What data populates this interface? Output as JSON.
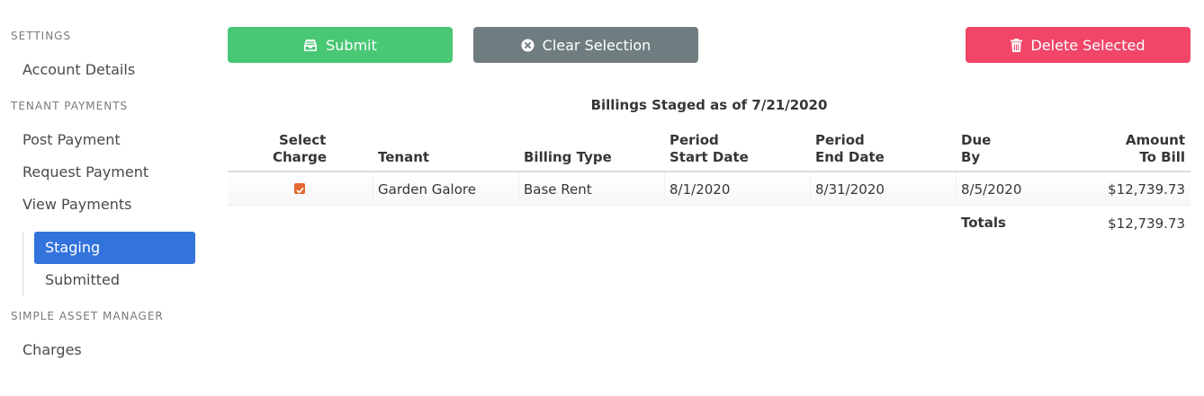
{
  "sidebar": {
    "sections": [
      {
        "label": "SETTINGS",
        "items": [
          "Account Details"
        ]
      },
      {
        "label": "TENANT PAYMENTS",
        "items": [
          "Post Payment",
          "Request Payment",
          "View Payments"
        ]
      },
      {
        "label": "SIMPLE ASSET MANAGER",
        "items": [
          "Charges"
        ]
      }
    ],
    "sub_items": [
      "Staging",
      "Submitted"
    ],
    "active_sub_item": "Staging"
  },
  "toolbar": {
    "submit_label": "Submit",
    "clear_label": "Clear Selection",
    "delete_label": "Delete Selected"
  },
  "table": {
    "caption": "Billings Staged as of 7/21/2020",
    "headers": [
      {
        "line1": "Select",
        "line2": "Charge"
      },
      {
        "line1": "",
        "line2": "Tenant"
      },
      {
        "line1": "",
        "line2": "Billing Type"
      },
      {
        "line1": "Period",
        "line2": "Start Date"
      },
      {
        "line1": "Period",
        "line2": "End Date"
      },
      {
        "line1": "Due",
        "line2": "By"
      },
      {
        "line1": "Amount",
        "line2": "To Bill"
      }
    ],
    "rows": [
      {
        "selected": true,
        "tenant": "Garden Galore",
        "billing_type": "Base Rent",
        "period_start": "8/1/2020",
        "period_end": "8/31/2020",
        "due_by": "8/5/2020",
        "amount": "$12,739.73"
      }
    ],
    "totals_label": "Totals",
    "totals_amount": "$12,739.73"
  },
  "colors": {
    "submit": "#48c774",
    "clear": "#6f7d80",
    "delete": "#f14668",
    "active_nav": "#3273dc",
    "checkbox": "#e2672e"
  },
  "icons": {
    "submit": "inbox-tray-icon",
    "clear": "times-circle-icon",
    "delete": "trash-icon",
    "checkbox": "check-icon"
  }
}
